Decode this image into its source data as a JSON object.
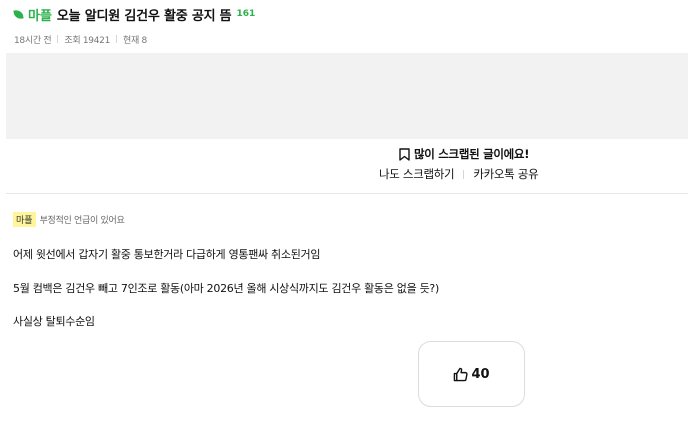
{
  "post": {
    "category": "마플",
    "title": "오늘 알디원 김건우 활중 공지 뜸",
    "comment_count": "161",
    "time_ago": "18시간 전",
    "views": "조회 19421",
    "current": "현재 8"
  },
  "scrap": {
    "message": "많이 스크랩된 글이에요!",
    "scrap_button": "나도 스크랩하기",
    "kakao_share": "카카오톡 공유"
  },
  "notice": {
    "badge": "마플",
    "text": "부정적인 언급이 있어요"
  },
  "content": {
    "lines": [
      "어제 윗선에서 갑자기 활중 통보한거라 다급하게 영통팬싸 취소된거임",
      "5월 컴백은 김건우 빼고 7인조로 활동(아마 2026년 올해 시상식까지도 김건우 활동은 없을 듯?)",
      "사실상 탈퇴수순임"
    ]
  },
  "like": {
    "count": "40"
  },
  "colors": {
    "accent_green": "#2bb24c",
    "badge_yellow": "#fff59a"
  }
}
